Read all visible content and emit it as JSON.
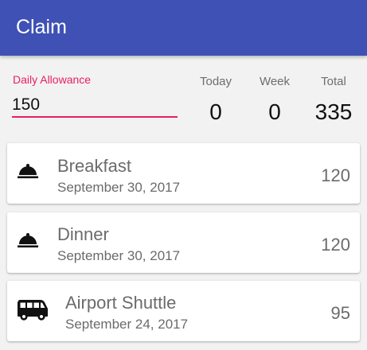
{
  "app": {
    "title": "Claim"
  },
  "allowance": {
    "label": "Daily Allowance",
    "value": "150"
  },
  "stats": {
    "today": {
      "label": "Today",
      "value": "0"
    },
    "week": {
      "label": "Week",
      "value": "0"
    },
    "total": {
      "label": "Total",
      "value": "335"
    }
  },
  "claims": [
    {
      "icon": "meal-cloche-icon",
      "title": "Breakfast",
      "date": "September 30, 2017",
      "amount": "120"
    },
    {
      "icon": "meal-cloche-icon",
      "title": "Dinner",
      "date": "September 30, 2017",
      "amount": "120"
    },
    {
      "icon": "bus-icon",
      "title": "Airport Shuttle",
      "date": "September 24, 2017",
      "amount": "95"
    }
  ],
  "colors": {
    "primary": "#3f51b5",
    "accent": "#e91e63"
  }
}
